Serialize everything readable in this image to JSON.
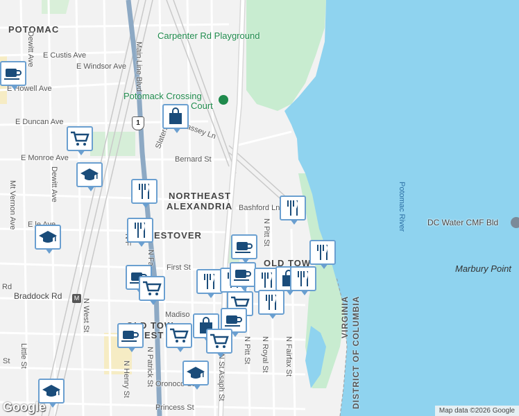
{
  "map": {
    "water_label": "Potomac River",
    "state_labels": [
      "VIRGINIA",
      "DISTRICT OF COLUMBIA"
    ],
    "places": {
      "potomac": "POTOMAC",
      "northeast": "NORTHEAST",
      "alexandria": "ALEXANDRIA",
      "westover": "ESTOVER",
      "old_town": "OLD TOW",
      "old_town_west": "OLD TOW",
      "old_town_west_2": "EST"
    },
    "pois": {
      "playground": "Carpenter Rd Playground",
      "potomack1": "Potomack Crossing",
      "potomack2": "Court",
      "dc_water": "DC Water CMF Bld",
      "marbury": "Marbury Point",
      "braddock": "Braddock Rd"
    },
    "streets": {
      "e_custis": "E Custis Ave",
      "e_windsor": "E Windsor Ave",
      "e_howell": "E Howell Ave",
      "e_duncan": "E Duncan Ave",
      "e_monroe": "E Monroe Ave",
      "e_le": "E    le Ave",
      "main_line": "Main Line Blvd",
      "dewitt1": "Dewitt Ave",
      "dewitt2": "Dewitt Ave",
      "mt_vernon": "Mt Vernon Ave",
      "bernard": "Bernard St",
      "massey": "assey Ln",
      "slaters": "Slaters Ln",
      "bashford": "Bashford Ln",
      "n_pitt": "N Pitt St",
      "n_pitt2": "N Pitt St",
      "first": "First St",
      "madison": "Madiso",
      "n_west": "N West St",
      "n_henry": "N Henry St",
      "n_patrick": "N Patrick St",
      "n_asaph": "N St Asaph St",
      "n_royal": "N Royal St",
      "n_fairfax": "N Fairfax St",
      "oronoco": "Oronoco St",
      "princess": "Princess St",
      "little": "Little St",
      "rd": "Rd",
      "st": "St",
      "nf": "N F",
      "nfa": "N Fa"
    },
    "route_shield": "1",
    "attribution": "Map data ©2026 Google",
    "logo": "Google"
  },
  "markers": [
    {
      "type": "coffee"
    },
    {
      "type": "shopping-bag"
    },
    {
      "type": "shopping-cart"
    },
    {
      "type": "school"
    },
    {
      "type": "restaurant"
    },
    {
      "type": "restaurant"
    },
    {
      "type": "school"
    },
    {
      "type": "restaurant"
    },
    {
      "type": "coffee"
    },
    {
      "type": "restaurant"
    },
    {
      "type": "coffee"
    },
    {
      "type": "shopping-cart"
    },
    {
      "type": "restaurant"
    },
    {
      "type": "restaurant"
    },
    {
      "type": "coffee"
    },
    {
      "type": "restaurant"
    },
    {
      "type": "shopping-bag"
    },
    {
      "type": "restaurant"
    },
    {
      "type": "shopping-cart"
    },
    {
      "type": "restaurant"
    },
    {
      "type": "coffee"
    },
    {
      "type": "shopping-bag"
    },
    {
      "type": "coffee"
    },
    {
      "type": "shopping-cart"
    },
    {
      "type": "shopping-cart"
    },
    {
      "type": "school"
    },
    {
      "type": "school"
    }
  ],
  "colors": {
    "water": "#8fd3ef",
    "park": "#c8ecd0",
    "marker_border": "#6a9fd0",
    "icon": "#1a4c7a"
  }
}
